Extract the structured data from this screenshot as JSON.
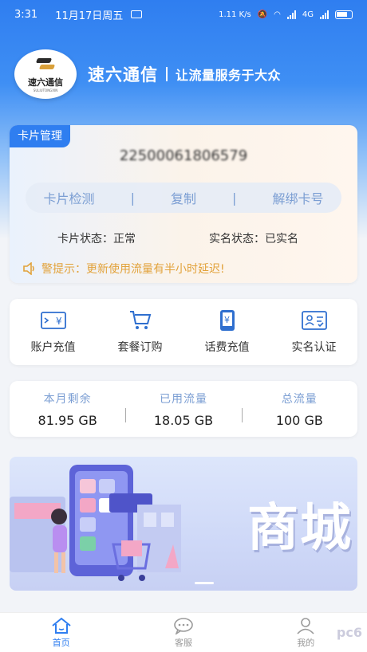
{
  "status_bar": {
    "time": "3:31",
    "date": "11月17日周五",
    "net_speed": "1.11 K/s",
    "network": "4G"
  },
  "brand": {
    "logo_text": "速六通信",
    "logo_sub": "SULIUTONGXIN",
    "name": "速六通信",
    "slogan": "让流量服务于大众"
  },
  "card_manage": {
    "tag": "卡片管理",
    "card_number": "22500061806579",
    "ops": [
      "卡片检测",
      "复制",
      "解绑卡号"
    ],
    "card_status_label": "卡片状态：",
    "card_status_value": "正常",
    "realname_label": "实名状态：",
    "realname_value": "已实名",
    "notice": "警提示：更新使用流量有半小时延迟!"
  },
  "actions": [
    {
      "label": "账户充值",
      "icon": "account-recharge-icon"
    },
    {
      "label": "套餐订购",
      "icon": "cart-icon"
    },
    {
      "label": "话费充值",
      "icon": "phone-recharge-icon"
    },
    {
      "label": "实名认证",
      "icon": "id-card-icon"
    }
  ],
  "flow": [
    {
      "title": "本月剩余",
      "value": "81.95 GB"
    },
    {
      "title": "已用流量",
      "value": "18.05 GB"
    },
    {
      "title": "总流量",
      "value": "100 GB"
    }
  ],
  "banner": {
    "title": "商城"
  },
  "tabbar": [
    {
      "label": "首页",
      "icon": "home-icon",
      "active": true
    },
    {
      "label": "客服",
      "icon": "chat-icon",
      "active": false
    },
    {
      "label": "我的",
      "icon": "user-icon",
      "active": false
    }
  ],
  "watermark": "pc6",
  "colors": {
    "primary": "#2f7ef0",
    "accent_text": "#7b9ed3",
    "notice": "#e2a23a"
  }
}
